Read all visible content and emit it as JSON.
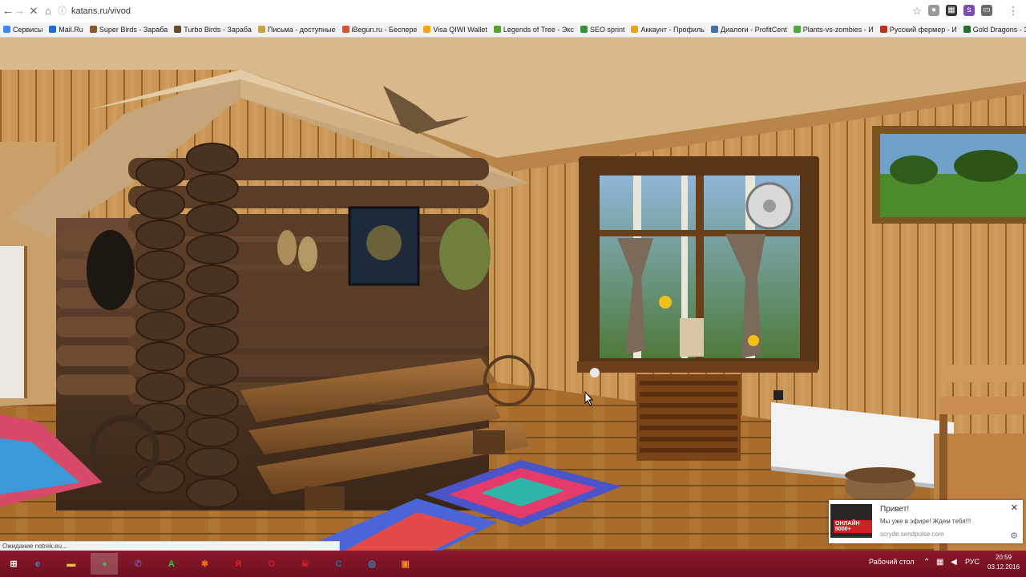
{
  "browser": {
    "url": "katans.ru/vivod",
    "bookmarks": [
      {
        "label": "Сервисы",
        "color": "#4285f4"
      },
      {
        "label": "Mail.Ru",
        "color": "#1a6ed8"
      },
      {
        "label": "Super Birds - Зараба",
        "color": "#8a5a2b"
      },
      {
        "label": "Turbo Birds - Зараба",
        "color": "#6b4a2b"
      },
      {
        "label": "Письма - доступные",
        "color": "#c6a24a"
      },
      {
        "label": "iBegun.ru - Беспере",
        "color": "#d4552b"
      },
      {
        "label": "Visa QIWI Wallet",
        "color": "#f7a21b"
      },
      {
        "label": "Legends of Tree - Экс",
        "color": "#5aa02c"
      },
      {
        "label": "SEO sprint",
        "color": "#3b8f3b"
      },
      {
        "label": "Аккаунт - Профиль",
        "color": "#e8a317"
      },
      {
        "label": "Диалоги - ProfitCent",
        "color": "#4a6ea8"
      },
      {
        "label": "Plants-vs-zombies - И",
        "color": "#4fa83d"
      },
      {
        "label": "Русский фермер - И",
        "color": "#b5331f"
      },
      {
        "label": "Gold Dragons - Зараб",
        "color": "#2b6b2b"
      }
    ]
  },
  "status_bar": {
    "text": "Ожидание notrek.eu..."
  },
  "notification": {
    "title": "Привет!",
    "message": "Мы уже в эфире! Ждем тебя!!!",
    "site": "scryde.sendpulse.com",
    "thumb_text": "ОНЛАЙН 5000+"
  },
  "taskbar": {
    "desktop_label": "Рабочий стол",
    "language": "РУС",
    "time": "20:59",
    "date": "03.12.2016",
    "apps": [
      {
        "name": "windows-start",
        "glyph": "⊞",
        "color": "#ffffff"
      },
      {
        "name": "internet-explorer",
        "glyph": "e",
        "color": "#2b8fd6"
      },
      {
        "name": "file-explorer",
        "glyph": "▬",
        "color": "#f2c14e"
      },
      {
        "name": "chrome",
        "glyph": "●",
        "color": "#4caf50"
      },
      {
        "name": "viber",
        "glyph": "✆",
        "color": "#7b519d"
      },
      {
        "name": "a-app",
        "glyph": "A",
        "color": "#2ecc40"
      },
      {
        "name": "orange-app",
        "glyph": "✱",
        "color": "#f26b1d"
      },
      {
        "name": "yandex",
        "glyph": "Я",
        "color": "#e0241a"
      },
      {
        "name": "opera",
        "glyph": "O",
        "color": "#cc1a2b"
      },
      {
        "name": "game-app",
        "glyph": "☠",
        "color": "#d61f26"
      },
      {
        "name": "c-app",
        "glyph": "C",
        "color": "#1b6fb5"
      },
      {
        "name": "amigo",
        "glyph": "◎",
        "color": "#1e9bd7"
      },
      {
        "name": "media-app",
        "glyph": "▣",
        "color": "#f58220"
      }
    ]
  }
}
